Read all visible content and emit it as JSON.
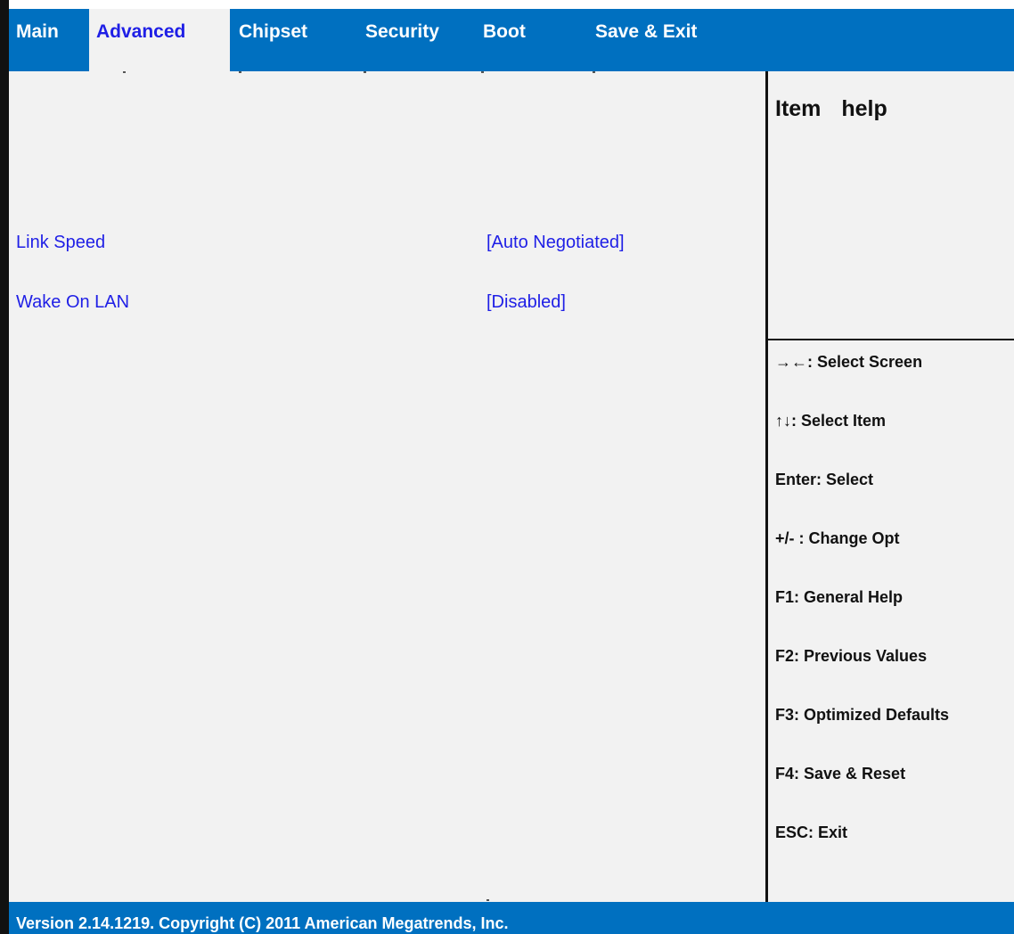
{
  "menu": {
    "tabs": [
      "Main",
      "Advanced",
      "Chipset",
      "Security",
      "Boot",
      "Save & Exit"
    ],
    "active": "Advanced"
  },
  "settings": [
    {
      "label": "Link Speed",
      "value": "[Auto Negotiated]"
    },
    {
      "label": "Wake On LAN",
      "value": "[Disabled]"
    }
  ],
  "help": {
    "title": "Item help",
    "keys": [
      "→←: Select Screen",
      "↑↓: Select Item",
      "Enter: Select",
      "+/- : Change Opt",
      "F1: General Help",
      "F2: Previous Values",
      "F3: Optimized Defaults",
      "F4: Save & Reset",
      "ESC: Exit"
    ]
  },
  "footer": {
    "text": "Version 2.14.1219. Copyright (C) 2011 American Megatrends, Inc."
  },
  "colors": {
    "bar": "#0070c0",
    "background": "#f2f2f2",
    "highlight_text": "#1f1fe6"
  }
}
